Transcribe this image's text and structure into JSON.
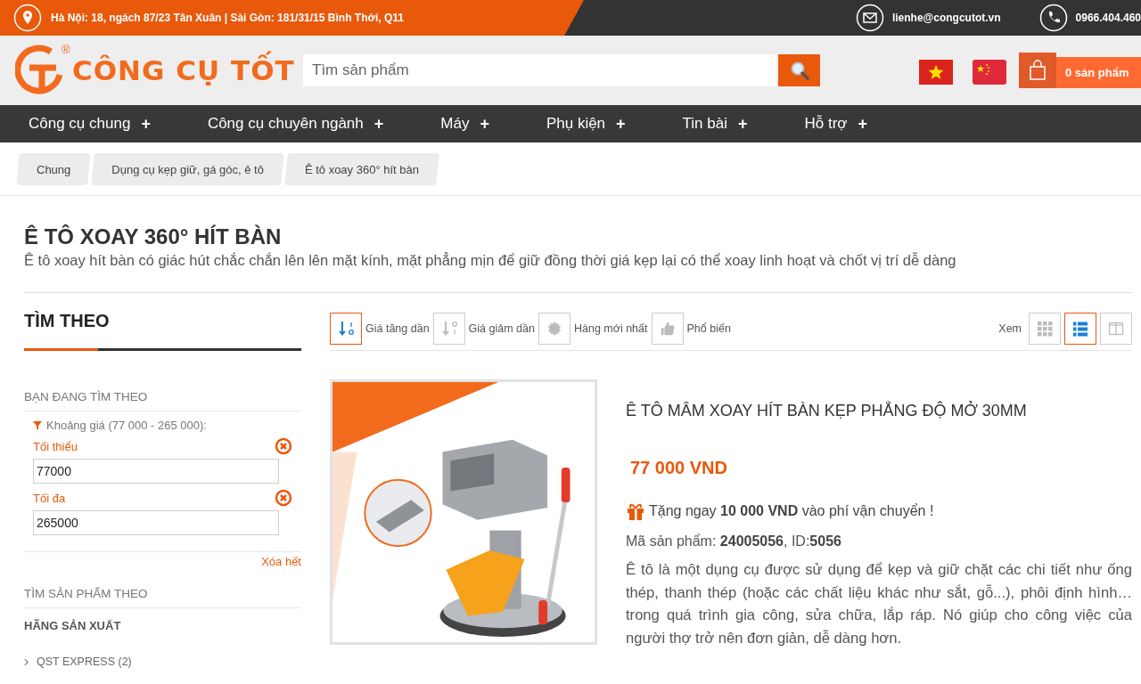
{
  "top_bar": {
    "address": "Hà Nội: 18, ngách 87/23 Tân Xuân | Sài Gòn: 181/31/15 Bình Thới, Q11",
    "email": "lienhe@congcutot.vn",
    "phone": "0966.404.460"
  },
  "header": {
    "logo": {
      "text": "CÔNG CỤ TỐT",
      "registered": "®"
    },
    "search": {
      "placeholder": "Tìm sản phẩm"
    },
    "cart": {
      "label": "0 sản phẩm"
    }
  },
  "nav": [
    {
      "label": "Công cụ chung",
      "expand": "+"
    },
    {
      "label": "Công cụ chuyên ngành",
      "expand": "+"
    },
    {
      "label": "Máy",
      "expand": "+"
    },
    {
      "label": "Phụ kiện",
      "expand": "+"
    },
    {
      "label": "Tin bài",
      "expand": "+"
    },
    {
      "label": "Hỗ trợ",
      "expand": "+"
    }
  ],
  "breadcrumbs": [
    "Chung",
    "Dụng cụ kẹp giữ, gá góc, ê tô",
    "Ê tô xoay 360° hít bàn"
  ],
  "page": {
    "title": "Ê TÔ XOAY 360° HÍT BÀN",
    "description": "Ê tô xoay hít bàn có giác hút chắc chắn lên lên mặt kính, mặt phẳng mịn để giữ đồng thời giá kẹp lại có thể xoay linh hoạt và chốt vị trí dễ dàng"
  },
  "sidebar": {
    "heading": "TÌM THEO",
    "current_heading": "BẠN ĐANG TÌM THEO",
    "filter_label": "Khoảng giá (77 000 - 265 000):",
    "fields": [
      {
        "label": "Tối thiểu",
        "value": "77000"
      },
      {
        "label": "Tối đa",
        "value": "265000"
      }
    ],
    "clear_link": "Xóa hết",
    "browse_heading": "TÌM SẢN PHẨM THEO",
    "groups": [
      {
        "heading": "HÃNG SẢN XUẤT",
        "items": [
          "QST EXPRESS (2)"
        ]
      }
    ]
  },
  "toolbar": {
    "sort_options": [
      {
        "kind": "asc",
        "label": "Giá tăng dần",
        "selected": true
      },
      {
        "kind": "desc",
        "label": "Giá giảm dần",
        "selected": false
      },
      {
        "kind": "new",
        "label": "Hàng mới nhất",
        "selected": false
      },
      {
        "kind": "popular",
        "label": "Phổ biến",
        "selected": false
      }
    ],
    "view_label": "Xem",
    "view_modes": [
      {
        "kind": "grid",
        "selected": false
      },
      {
        "kind": "list",
        "selected": true
      },
      {
        "kind": "columns",
        "selected": false
      }
    ]
  },
  "product": {
    "name": "Ê TÔ MÂM XOAY HÍT BÀN KẸP PHẲNG ĐỘ MỞ 30MM",
    "price": "77 000 VND",
    "promo": "Tặng ngay **10 000 VND** vào phí vận chuyển !",
    "code": "Mã sản phẩm: **24005056**, ID:**5056**",
    "description": "Ê tô là một dụng cụ được sử dụng để kẹp và giữ chặt các chi tiết như ống thép, thanh thép (hoặc các chất liệu khác như sắt, gỗ...), phôi định hình… trong quá trình gia công, sửa chữa, lắp ráp. Nó giúp cho công việc của người thợ trở nên đơn giản, dễ dàng hơn."
  }
}
